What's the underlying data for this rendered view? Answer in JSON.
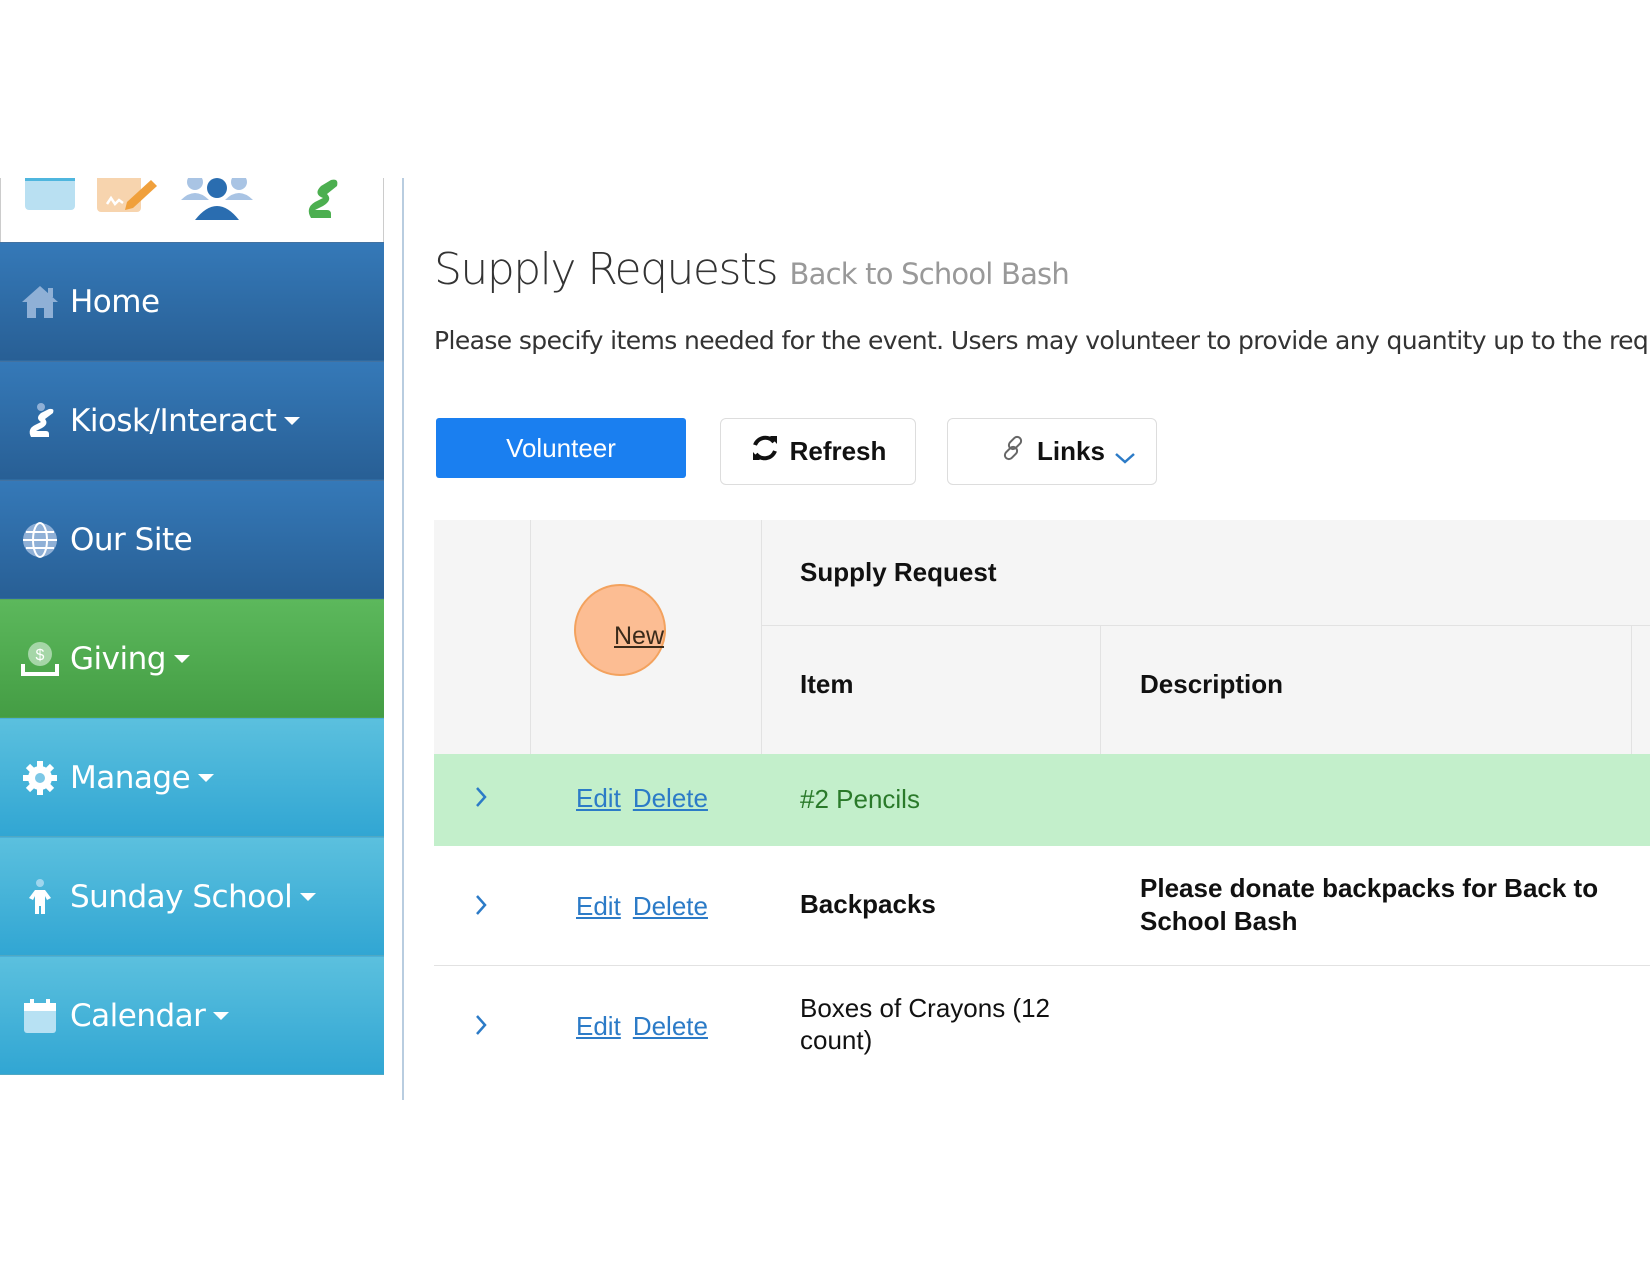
{
  "top_icons": [
    {
      "name": "window-icon"
    },
    {
      "name": "signature-pencil-icon"
    },
    {
      "name": "people-group-icon"
    },
    {
      "name": "praying-person-icon"
    }
  ],
  "sidebar": {
    "items": [
      {
        "label": "Home",
        "icon": "home-icon",
        "has_caret": false,
        "theme": "blue"
      },
      {
        "label": "Kiosk/Interact",
        "icon": "praying-person-icon",
        "has_caret": true,
        "theme": "blue"
      },
      {
        "label": "Our Site",
        "icon": "globe-icon",
        "has_caret": false,
        "theme": "blue"
      },
      {
        "label": "Giving",
        "icon": "money-hand-icon",
        "has_caret": true,
        "theme": "green"
      },
      {
        "label": "Manage",
        "icon": "gear-icon",
        "has_caret": true,
        "theme": "cyan"
      },
      {
        "label": "Sunday School",
        "icon": "child-icon",
        "has_caret": true,
        "theme": "cyan"
      },
      {
        "label": "Calendar",
        "icon": "calendar-icon",
        "has_caret": true,
        "theme": "cyan"
      }
    ]
  },
  "page": {
    "title": "Supply Requests",
    "subtitle": "Back to School Bash",
    "description": "Please specify items needed for the event. Users may volunteer to provide any quantity up to the requ"
  },
  "toolbar": {
    "volunteer_label": "Volunteer",
    "refresh_label": "Refresh",
    "links_label": "Links"
  },
  "table": {
    "new_label": "New",
    "group_header": "Supply Request",
    "columns": [
      "Item",
      "Description"
    ],
    "row_actions": {
      "edit": "Edit",
      "delete": "Delete"
    },
    "rows": [
      {
        "item": "#2 Pencils",
        "description": "",
        "selected": true
      },
      {
        "item": "Backpacks",
        "description": "Please donate backpacks for Back to School Bash",
        "selected": false
      },
      {
        "item": "Boxes of Crayons (12 count)",
        "description": "",
        "selected": false
      }
    ]
  },
  "colors": {
    "sidebar_blue": "#3579b8",
    "sidebar_green": "#5cb85c",
    "sidebar_cyan": "#5bc0de",
    "volunteer_button": "#1a7ff0",
    "selected_row": "#c3efcb",
    "selected_row_text": "#2a7a2a",
    "link": "#2c7bc7",
    "highlight_circle": "#ffa76e"
  }
}
